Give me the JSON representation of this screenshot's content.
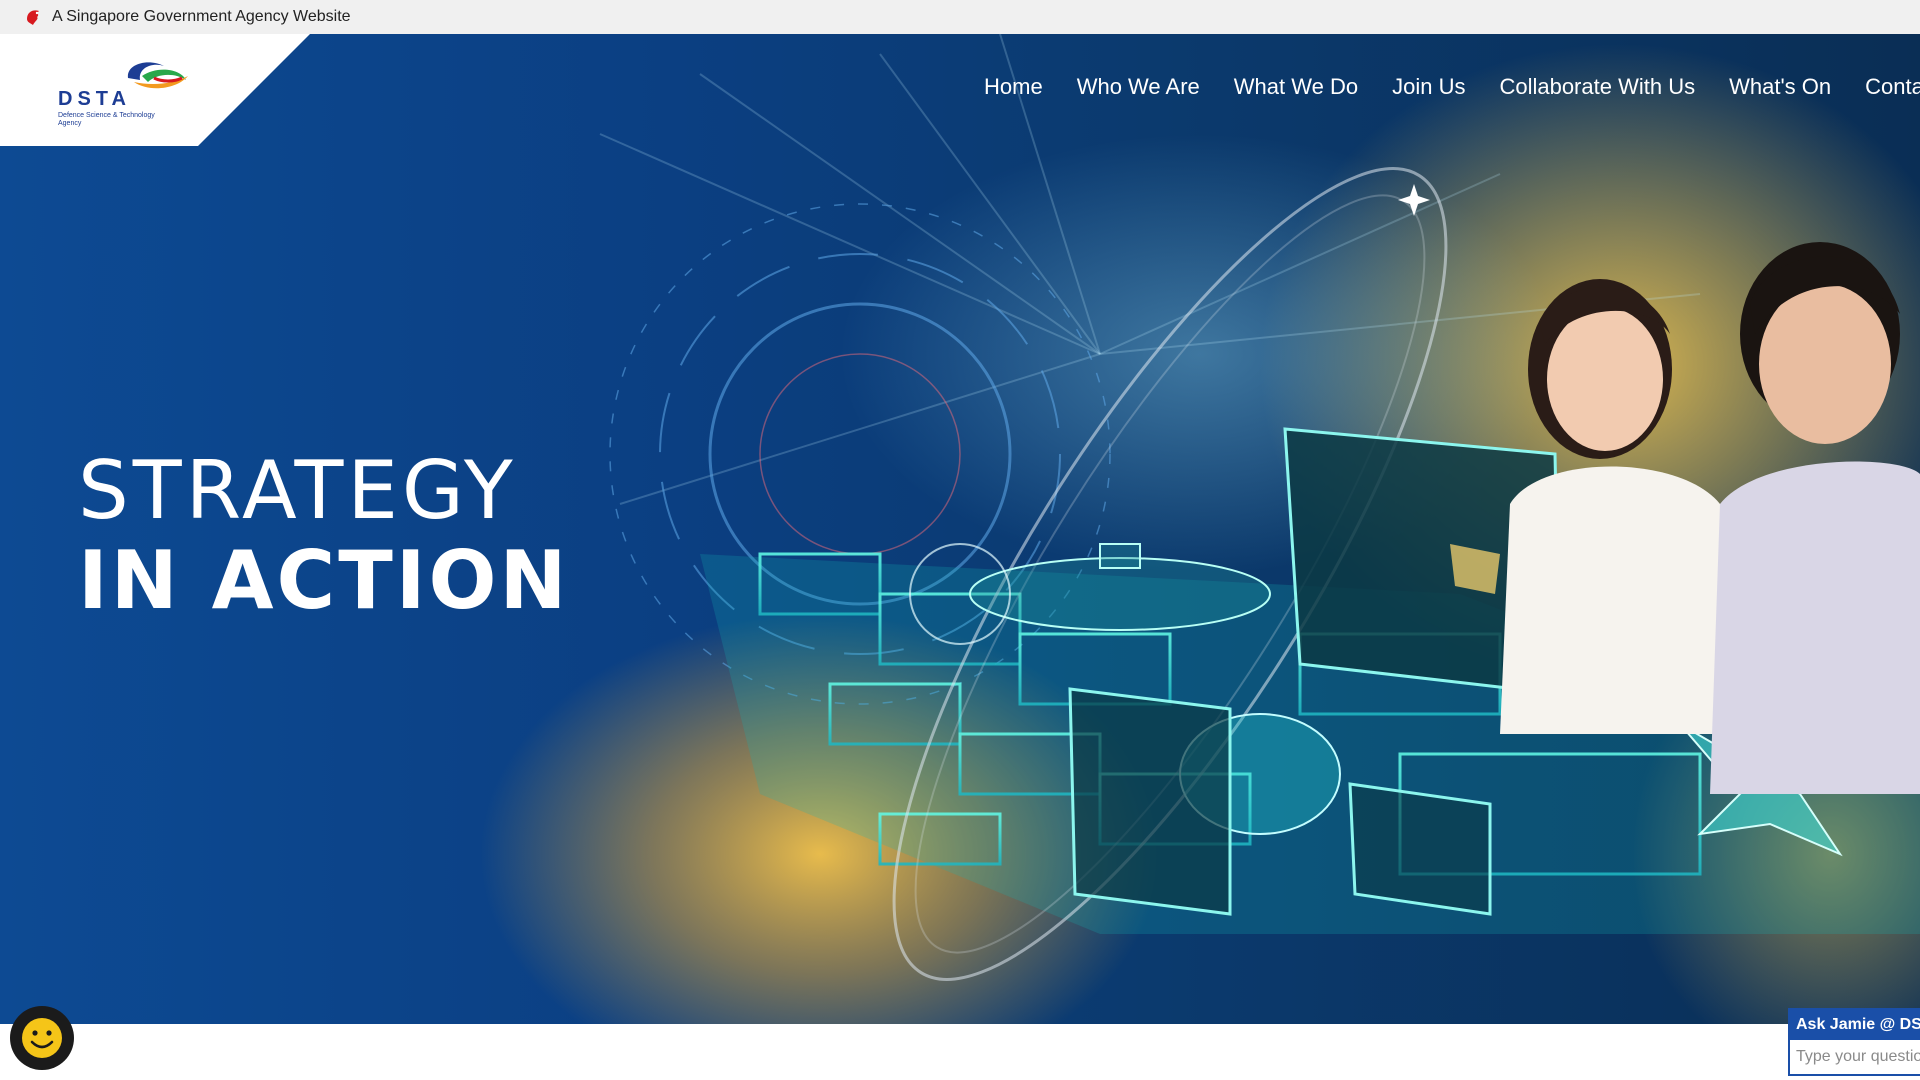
{
  "masthead": {
    "text": "A Singapore Government Agency Website",
    "icon": "lion-head-icon",
    "icon_color": "#d7191f"
  },
  "logo": {
    "wordmark": "DSTA",
    "subtitle": "Defence Science & Technology Agency"
  },
  "nav": {
    "items": [
      {
        "label": "Home"
      },
      {
        "label": "Who We Are"
      },
      {
        "label": "What We Do"
      },
      {
        "label": "Join Us"
      },
      {
        "label": "Collaborate With Us"
      },
      {
        "label": "What's On"
      },
      {
        "label": "Contact Us"
      }
    ]
  },
  "hero": {
    "headline_line1": "STRATEGY",
    "headline_line2": "IN ACTION",
    "colors": {
      "deep_blue": "#0a3f80",
      "teal": "#2ee6d0",
      "gold": "#e8b23a"
    }
  },
  "feedback": {
    "icon": "smiley-face-icon",
    "color": "#f5c518"
  },
  "chat": {
    "title": "Ask Jamie @ DSTA",
    "placeholder": "Type your question here"
  }
}
